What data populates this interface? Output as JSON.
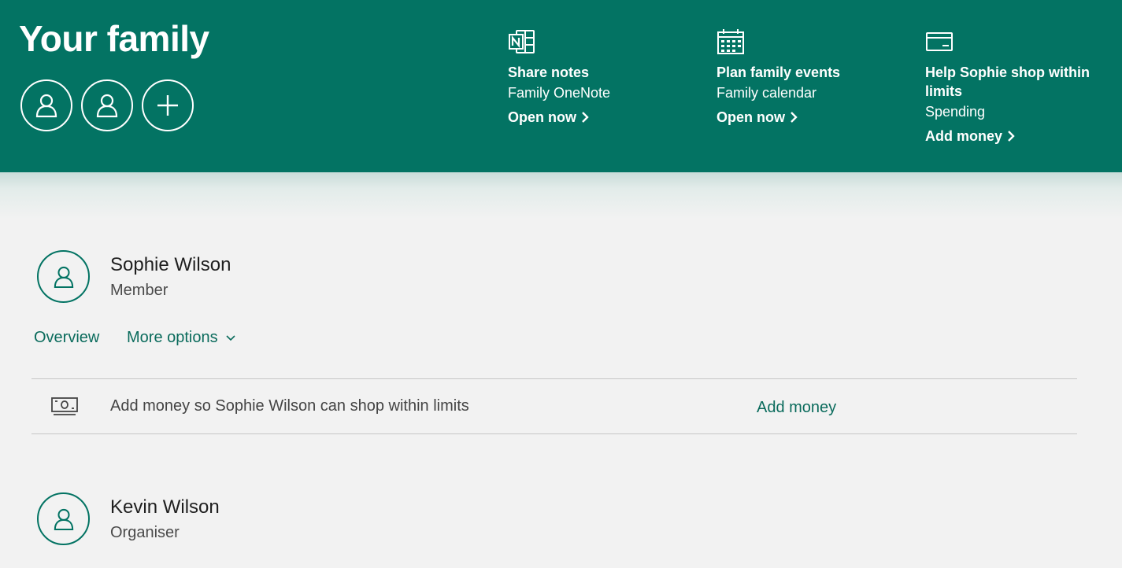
{
  "header": {
    "title": "Your family",
    "avatars": [
      "member-avatar-1",
      "member-avatar-2"
    ],
    "add_member_icon": "plus-icon"
  },
  "features": [
    {
      "icon": "onenote-icon",
      "title": "Share notes",
      "subtitle": "Family OneNote",
      "link": "Open now"
    },
    {
      "icon": "calendar-icon",
      "title": "Plan family events",
      "subtitle": "Family calendar",
      "link": "Open now"
    },
    {
      "icon": "wallet-icon",
      "title_line1": "Help Sophie shop within",
      "title_line2": "limits",
      "subtitle": "Spending",
      "link": "Add money"
    }
  ],
  "members": [
    {
      "name": "Sophie Wilson",
      "role": "Member",
      "tabs": {
        "overview": "Overview",
        "more": "More options"
      },
      "notice": {
        "text": "Add money so Sophie Wilson can shop within limits",
        "action": "Add money",
        "icon": "money-icon"
      }
    },
    {
      "name": "Kevin Wilson",
      "role": "Organiser"
    }
  ],
  "colors": {
    "brand": "#037363",
    "link": "#0a6b5c",
    "background": "#f2f2f2"
  }
}
